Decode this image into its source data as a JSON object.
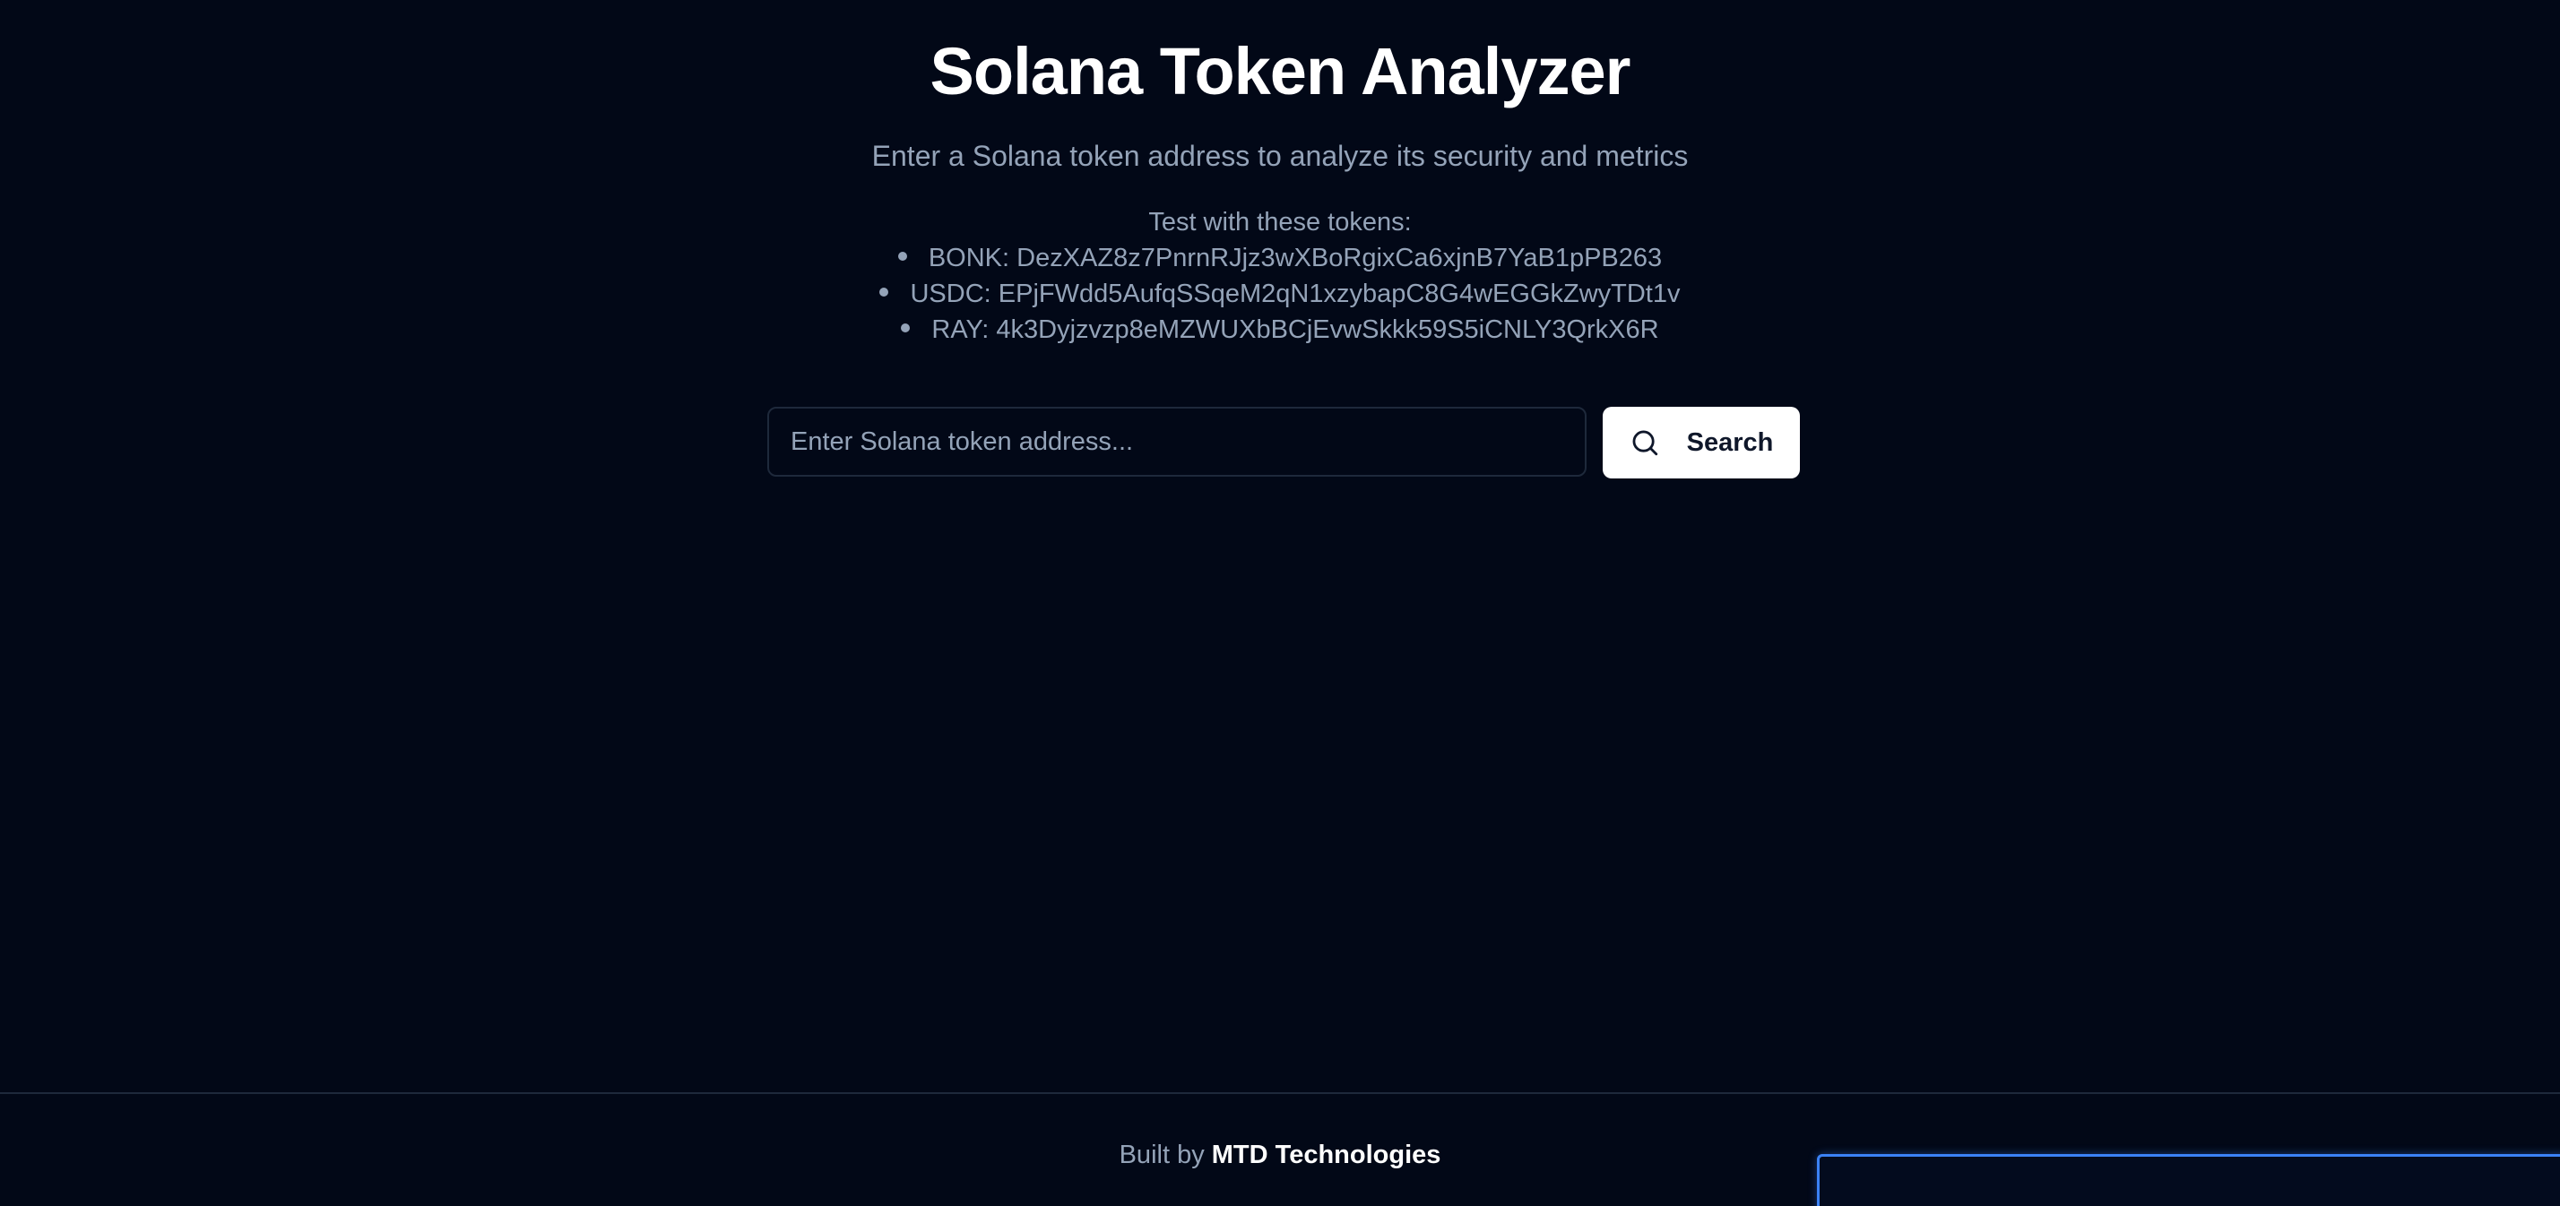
{
  "header": {
    "title": "Solana Token Analyzer",
    "subtitle": "Enter a Solana token address to analyze its security and metrics"
  },
  "test_tokens": {
    "heading": "Test with these tokens:",
    "items": [
      "BONK: DezXAZ8z7PnrnRJjz3wXBoRgixCa6xjnB7YaB1pPB263",
      "USDC: EPjFWdd5AufqSSqeM2qN1xzybapC8G4wEGGkZwyTDt1v",
      "RAY: 4k3Dyjzvzp8eMZWUXbBCjEvwSkkk59S5iCNLY3QrkX6R"
    ]
  },
  "search": {
    "placeholder": "Enter Solana token address...",
    "value": "",
    "button_label": "Search",
    "icon": "search-icon"
  },
  "footer": {
    "prefix": "Built by",
    "brand": "MTD Technologies"
  },
  "colors": {
    "background": "#020817",
    "muted_text": "#94a3b8",
    "border": "#1e293b",
    "button_bg": "#ffffff",
    "accent": "#3b82f6"
  }
}
